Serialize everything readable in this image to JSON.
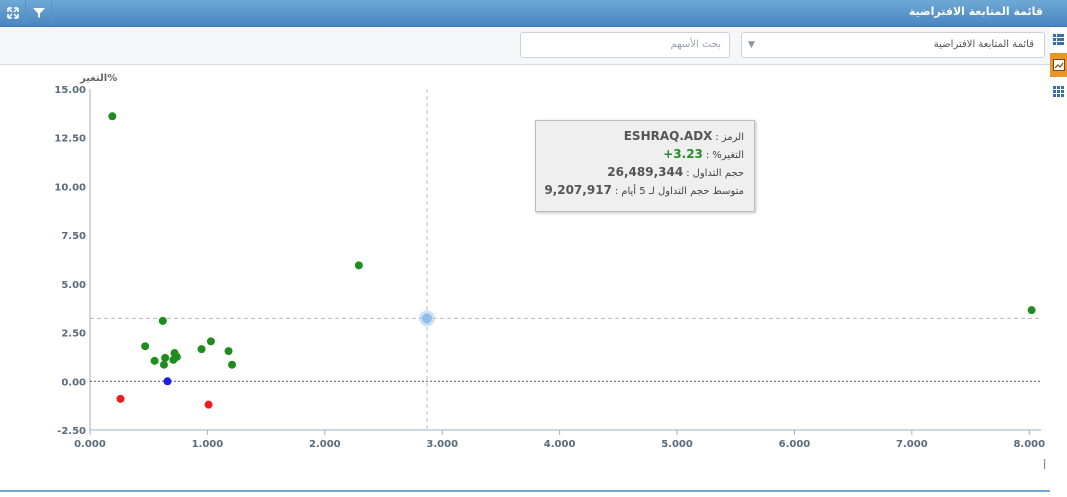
{
  "window": {
    "title": "قائمة المتابعة الافتراضية"
  },
  "icons": {
    "expand": "expand-icon",
    "filter": "filter-icon",
    "grid": "grid-icon",
    "chart": "chart-icon",
    "tiles": "tiles-icon"
  },
  "toolbar": {
    "search_placeholder": "بحث الأسهم",
    "watchlist_value": "قائمة المتابعة الافتراضية"
  },
  "tooltip": {
    "symbol_label": "الرمز",
    "symbol_value": "ESHRAQ.ADX",
    "change_label": "التغير%",
    "change_value": "+3.23",
    "volume_label": "حجم التداول",
    "volume_value": "26,489,344",
    "avg_label": "متوسط حجم التداول لـ 5 أيام",
    "avg_value": "9,207,917"
  },
  "colors": {
    "up": "#1e8c1e",
    "down": "#ee1c1c",
    "flat": "#1f1fe0",
    "highlight": "#8fbfe8",
    "title_bar": "#4a86bf"
  },
  "chart_data": {
    "type": "scatter",
    "ylabel": "التغير%",
    "xlabel": "أ",
    "xlim": [
      0,
      8.1
    ],
    "ylim": [
      -2.5,
      15
    ],
    "x_ticks": [
      "0.000",
      "1.000",
      "2.000",
      "3.000",
      "4.000",
      "5.000",
      "6.000",
      "7.000",
      "8.000"
    ],
    "y_ticks": [
      "15.00",
      "12.50",
      "10.00",
      "7.50",
      "5.00",
      "2.50",
      "0.00",
      "-2.50"
    ],
    "points": [
      {
        "x": 0.19,
        "y": 13.6,
        "status": "up"
      },
      {
        "x": 2.29,
        "y": 5.95,
        "status": "up"
      },
      {
        "x": 8.02,
        "y": 3.65,
        "status": "up"
      },
      {
        "x": 0.62,
        "y": 3.1,
        "status": "up"
      },
      {
        "x": 1.03,
        "y": 2.05,
        "status": "up"
      },
      {
        "x": 0.47,
        "y": 1.8,
        "status": "up"
      },
      {
        "x": 0.95,
        "y": 1.65,
        "status": "up"
      },
      {
        "x": 1.18,
        "y": 1.55,
        "status": "up"
      },
      {
        "x": 0.72,
        "y": 1.45,
        "status": "up"
      },
      {
        "x": 0.64,
        "y": 1.2,
        "status": "up"
      },
      {
        "x": 0.74,
        "y": 1.25,
        "status": "up"
      },
      {
        "x": 0.71,
        "y": 1.1,
        "status": "up"
      },
      {
        "x": 0.55,
        "y": 1.05,
        "status": "up"
      },
      {
        "x": 0.63,
        "y": 0.85,
        "status": "up"
      },
      {
        "x": 1.21,
        "y": 0.85,
        "status": "up"
      },
      {
        "x": 0.66,
        "y": 0.0,
        "status": "flat"
      },
      {
        "x": 0.26,
        "y": -0.9,
        "status": "down"
      },
      {
        "x": 1.01,
        "y": -1.2,
        "status": "down"
      }
    ],
    "highlight": {
      "x": 2.87,
      "y": 3.23
    }
  }
}
